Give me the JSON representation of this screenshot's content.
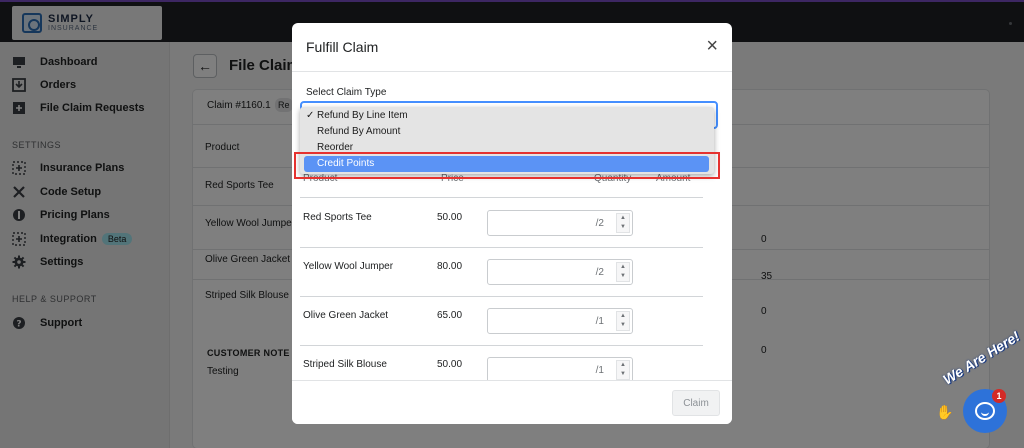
{
  "app": {
    "logo_title": "SIMPLY",
    "logo_sub": "INSURANCE"
  },
  "sidebar": {
    "items": [
      {
        "label": "Dashboard",
        "icon": "monitor-icon"
      },
      {
        "label": "Orders",
        "icon": "inbox-download-icon"
      },
      {
        "label": "File Claim Requests",
        "icon": "plus-square-icon"
      }
    ],
    "settings_heading": "SETTINGS",
    "settings_items": [
      {
        "label": "Insurance Plans",
        "icon": "dotted-plus-icon"
      },
      {
        "label": "Code Setup",
        "icon": "tools-icon"
      },
      {
        "label": "Pricing Plans",
        "icon": "coin-icon"
      },
      {
        "label": "Integration",
        "icon": "dotted-plus-icon",
        "badge": "Beta"
      },
      {
        "label": "Settings",
        "icon": "gear-icon"
      }
    ],
    "help_heading": "HELP & SUPPORT",
    "help_items": [
      {
        "label": "Support",
        "icon": "question-circle-icon"
      }
    ]
  },
  "page": {
    "title": "File Claim",
    "claim_number": "Claim #1160.1",
    "claim_tag": "Re",
    "column_product": "Product",
    "rows": [
      {
        "product": "Red Sports Tee",
        "value": ""
      },
      {
        "product": "Yellow Wool Jumpe",
        "value": "0"
      },
      {
        "product": "Olive Green Jacket",
        "value": "35"
      },
      {
        "product": "Striped Silk Blouse",
        "value": "0"
      }
    ],
    "extra_value": "0",
    "customer_note_label": "CUSTOMER NOTE",
    "customer_note": "Testing"
  },
  "modal": {
    "title": "Fulfill Claim",
    "close_icon": "×",
    "select_label": "Select Claim Type",
    "options": [
      {
        "label": "Refund By Line Item",
        "checked": true
      },
      {
        "label": "Refund By Amount",
        "checked": false
      },
      {
        "label": "Reorder",
        "checked": false
      },
      {
        "label": "Credit Points",
        "checked": false
      }
    ],
    "check_glyph": "✓",
    "table": {
      "col_product": "Product",
      "col_price": "Price",
      "col_quantity": "Quantity",
      "col_amount": "Amount",
      "rows": [
        {
          "product": "Red Sports Tee",
          "price": "50.00",
          "max": "/2"
        },
        {
          "product": "Yellow Wool Jumper",
          "price": "80.00",
          "max": "/2"
        },
        {
          "product": "Olive Green Jacket",
          "price": "65.00",
          "max": "/1"
        },
        {
          "product": "Striped Silk Blouse",
          "price": "50.00",
          "max": "/1"
        }
      ]
    },
    "claim_button": "Claim"
  },
  "chat": {
    "tagline": "We Are Here!",
    "unread_count": "1"
  },
  "colors": {
    "accent": "#458fff",
    "highlight_option": "#5b93f5",
    "annotation_border": "#e5322f",
    "chat": "#2d72d9"
  }
}
